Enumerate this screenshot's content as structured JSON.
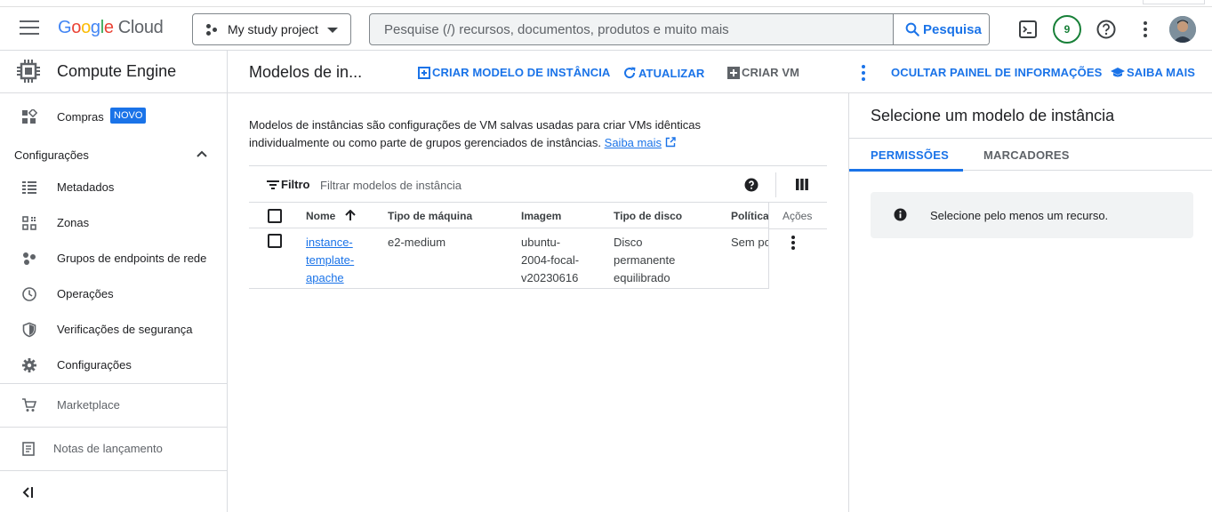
{
  "header": {
    "logo_google_letters": [
      "G",
      "o",
      "o",
      "g",
      "l",
      "e"
    ],
    "logo_cloud": "Cloud",
    "project_name": "My study project",
    "search_placeholder": "Pesquise (/) recursos, documentos, produtos e muito mais",
    "search_button": "Pesquisa",
    "notifications_count": "9",
    "icons": [
      "menu-icon",
      "terminal-icon",
      "help-icon",
      "more-vert-icon",
      "avatar"
    ]
  },
  "sidebar": {
    "product_title": "Compute Engine",
    "compras": {
      "label": "Compras",
      "badge": "NOVO"
    },
    "section_title": "Configurações",
    "items": [
      {
        "label": "Metadados",
        "icon": "list-icon"
      },
      {
        "label": "Zonas",
        "icon": "grid-icon"
      },
      {
        "label": "Grupos de endpoints de rede",
        "icon": "endpoints-icon"
      },
      {
        "label": "Operações",
        "icon": "clock-icon"
      },
      {
        "label": "Verificações de segurança",
        "icon": "shield-icon"
      },
      {
        "label": "Configurações",
        "icon": "gear-icon"
      }
    ],
    "marketplace": "Marketplace",
    "release_notes": "Notas de lançamento",
    "collapse_icon": "collapse-icon"
  },
  "toolbar": {
    "page_title": "Modelos de in...",
    "create_template": "CRIAR MODELO DE INSTÂNCIA",
    "refresh": "ATUALIZAR",
    "create_vm": "CRIAR VM",
    "hide_panel": "OCULTAR PAINEL DE INFORMAÇÕES",
    "learn_more": "SAIBA MAIS"
  },
  "main": {
    "description": "Modelos de instâncias são configurações de VM salvas usadas para criar VMs idênticas individualmente ou como parte de grupos gerenciados de instâncias.",
    "description_link": "Saiba mais",
    "filter_label": "Filtro",
    "filter_placeholder": "Filtrar modelos de instância",
    "columns": [
      "Nome",
      "Tipo de máquina",
      "Imagem",
      "Tipo de disco",
      "Política",
      "Ações"
    ],
    "rows": [
      {
        "name_lines": [
          "instance-",
          "template-",
          "apache"
        ],
        "machine_type": "e2-medium",
        "image_lines": [
          "ubuntu-",
          "2004-focal-",
          "v20230616"
        ],
        "disk_lines": [
          "Disco",
          "permanente",
          "equilibrado"
        ],
        "policy": "Sem po"
      }
    ]
  },
  "info_panel": {
    "title": "Selecione um modelo de instância",
    "tabs": [
      "PERMISSÕES",
      "MARCADORES"
    ],
    "active_tab": "PERMISSÕES",
    "message": "Selecione pelo menos um recurso."
  },
  "colors": {
    "accent": "#1a73e8",
    "badge_green": "#188038",
    "text": "#202124",
    "muted": "#5f6368"
  }
}
